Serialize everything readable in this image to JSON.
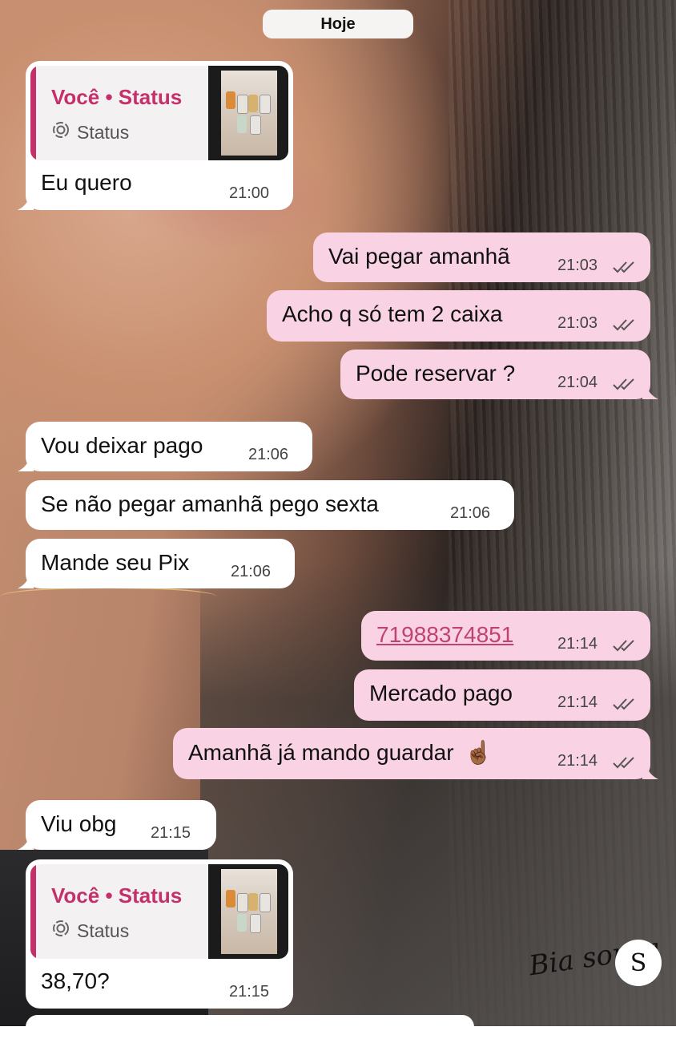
{
  "date_separator": "Hoje",
  "messages": [
    {
      "id": "m1",
      "dir": "in",
      "reply": {
        "author": "Você • Status",
        "label": "Status"
      },
      "text": "Eu quero",
      "time": "21:00"
    },
    {
      "id": "m2",
      "dir": "out",
      "text": "Vai pegar amanhã",
      "time": "21:03",
      "status": "read"
    },
    {
      "id": "m3",
      "dir": "out",
      "text": "Acho q só tem 2 caixa",
      "time": "21:03",
      "status": "read"
    },
    {
      "id": "m4",
      "dir": "out",
      "text": "Pode reservar ?",
      "time": "21:04",
      "status": "read"
    },
    {
      "id": "m5",
      "dir": "in",
      "text": "Vou deixar pago",
      "time": "21:06"
    },
    {
      "id": "m6",
      "dir": "in",
      "text": "Se não pegar amanhã pego sexta",
      "time": "21:06"
    },
    {
      "id": "m7",
      "dir": "in",
      "text": "Mande seu Pix",
      "time": "21:06"
    },
    {
      "id": "m8",
      "dir": "out",
      "text": "71988374851",
      "time": "21:14",
      "status": "read",
      "is_link": true
    },
    {
      "id": "m9",
      "dir": "out",
      "text": "Mercado pago",
      "time": "21:14",
      "status": "read"
    },
    {
      "id": "m10",
      "dir": "out",
      "text": "Amanhã já mando guardar",
      "emoji": "☝🏾",
      "time": "21:14",
      "status": "read"
    },
    {
      "id": "m11",
      "dir": "in",
      "text": "Viu obg",
      "time": "21:15"
    },
    {
      "id": "m12",
      "dir": "in",
      "reply": {
        "author": "Você • Status",
        "label": "Status"
      },
      "text": "38,70?",
      "time": "21:15"
    }
  ],
  "watermark": {
    "text": "Bia souza",
    "monogram": "S"
  },
  "colors": {
    "incoming": "#ffffff",
    "outgoing": "#f9d3e3",
    "accent": "#c4306a",
    "link": "#c0436f"
  },
  "icons": {
    "status": "status-ring-icon",
    "read": "double-check-icon"
  }
}
